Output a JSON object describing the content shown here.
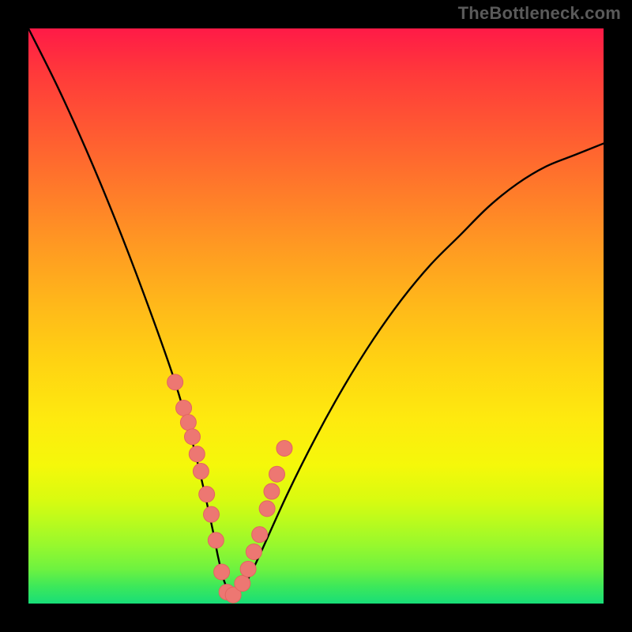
{
  "watermark": "TheBottleneck.com",
  "colors": {
    "frame": "#000000",
    "curve": "#000000",
    "marker_fill": "#ed7772",
    "marker_stroke": "#e26560",
    "gradient_top": "#ff1a47",
    "gradient_bottom": "#18de78"
  },
  "chart_data": {
    "type": "line",
    "title": "",
    "xlabel": "",
    "ylabel": "",
    "xlim": [
      0,
      1
    ],
    "ylim": [
      0,
      1
    ],
    "series": [
      {
        "name": "bottleneck-curve",
        "x": [
          0.0,
          0.05,
          0.1,
          0.15,
          0.2,
          0.25,
          0.28,
          0.3,
          0.32,
          0.33,
          0.34,
          0.35,
          0.36,
          0.38,
          0.4,
          0.45,
          0.5,
          0.55,
          0.6,
          0.65,
          0.7,
          0.75,
          0.8,
          0.85,
          0.9,
          0.95,
          1.0
        ],
        "y": [
          1.0,
          0.9,
          0.79,
          0.67,
          0.54,
          0.4,
          0.3,
          0.22,
          0.13,
          0.08,
          0.04,
          0.02,
          0.02,
          0.04,
          0.08,
          0.19,
          0.29,
          0.38,
          0.46,
          0.53,
          0.59,
          0.64,
          0.69,
          0.73,
          0.76,
          0.78,
          0.8
        ]
      }
    ],
    "markers": {
      "name": "highlighted-points",
      "x": [
        0.255,
        0.27,
        0.278,
        0.285,
        0.293,
        0.3,
        0.31,
        0.318,
        0.326,
        0.336,
        0.345,
        0.356,
        0.372,
        0.382,
        0.392,
        0.402,
        0.415,
        0.423,
        0.432,
        0.445
      ],
      "y": [
        0.385,
        0.34,
        0.315,
        0.29,
        0.26,
        0.23,
        0.19,
        0.155,
        0.11,
        0.055,
        0.02,
        0.015,
        0.035,
        0.06,
        0.09,
        0.12,
        0.165,
        0.195,
        0.225,
        0.27
      ]
    }
  }
}
